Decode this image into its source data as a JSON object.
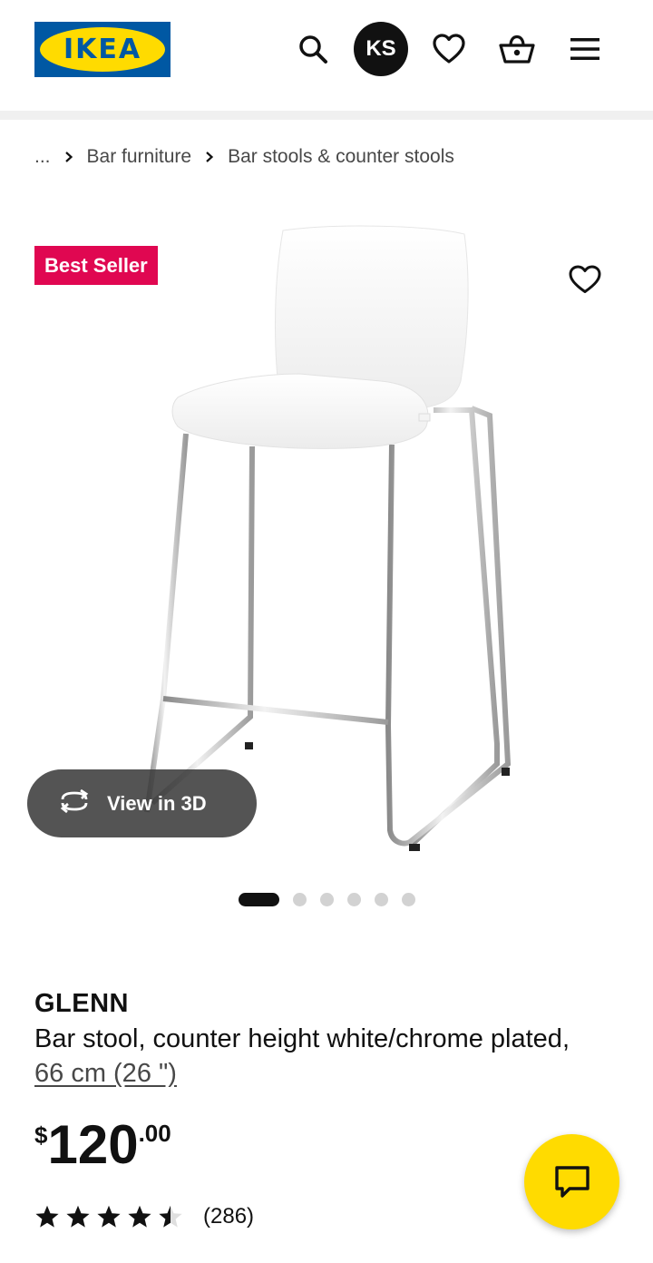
{
  "header": {
    "logo_text": "IKEA",
    "avatar_initials": "KS",
    "icons": [
      "search-icon",
      "heart-icon",
      "basket-icon",
      "menu-icon"
    ]
  },
  "breadcrumb": {
    "ellipsis": "...",
    "items": [
      "Bar furniture",
      "Bar stools & counter stools"
    ]
  },
  "gallery": {
    "badge": "Best Seller",
    "view3d_label": "View in 3D",
    "dots_total": 6,
    "active_dot": 1
  },
  "product": {
    "name": "GLENN",
    "description": "Bar stool, counter height white/chrome plated,",
    "size_link": "66 cm (26 \")",
    "price": {
      "currency": "$",
      "integer": "120",
      "decimal": ".00"
    },
    "rating": {
      "stars": 4.5,
      "out_of": 5,
      "count": "(286)"
    }
  },
  "colors": {
    "ikea_blue": "#0058a3",
    "ikea_yellow": "#ffdb00",
    "badge_red": "#e00751"
  }
}
